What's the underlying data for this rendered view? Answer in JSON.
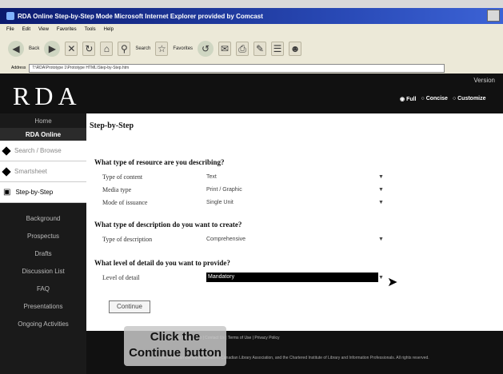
{
  "window": {
    "title": "RDA Online   Step-by-Step Mode   Microsoft Internet Explorer provided by Comcast"
  },
  "menu": [
    "File",
    "Edit",
    "View",
    "Favorites",
    "Tools",
    "Help"
  ],
  "toolbar": {
    "back_label": "Back",
    "search_label": "Search",
    "favorites_label": "Favorites"
  },
  "address": {
    "label": "Address",
    "url": "T:\\RDA\\Prototype 1\\Prototype HTML\\Step-by-Step.htm"
  },
  "header": {
    "logo": "RDA",
    "version_label": "Version",
    "view_options": [
      "Full",
      "Concise",
      "Customize"
    ]
  },
  "sidebar": {
    "home": "Home",
    "section_head": "RDA Online",
    "subitems": [
      "Search / Browse",
      "Smartsheet",
      "Step-by-Step"
    ],
    "links": [
      "Background",
      "Prospectus",
      "Drafts",
      "Discussion List",
      "FAQ",
      "Presentations",
      "Ongoing Activities"
    ]
  },
  "main": {
    "title": "Step-by-Step",
    "sections": [
      {
        "question": "What type of resource are you describing?",
        "rows": [
          {
            "label": "Type of content",
            "value": "Text"
          },
          {
            "label": "Media type",
            "value": "Print / Graphic"
          },
          {
            "label": "Mode of issuance",
            "value": "Single Unit"
          }
        ]
      },
      {
        "question": "What type of description do you want to create?",
        "rows": [
          {
            "label": "Type of description",
            "value": "Comprehensive"
          }
        ]
      },
      {
        "question": "What level of detail do you want to provide?",
        "rows": [
          {
            "label": "Level of detail",
            "value": "Mandatory"
          }
        ]
      }
    ],
    "continue_label": "Continue"
  },
  "footer": {
    "links": "Site Map  |  Help  |  Contact Us  |  Terms of Use  |  Privacy Policy",
    "text": "The American Library Association, Canadian Library Association, and the Chartered Institute of Library and Information Professionals. All rights reserved."
  },
  "callout": {
    "line1": "Click the",
    "line2": "Continue button"
  }
}
